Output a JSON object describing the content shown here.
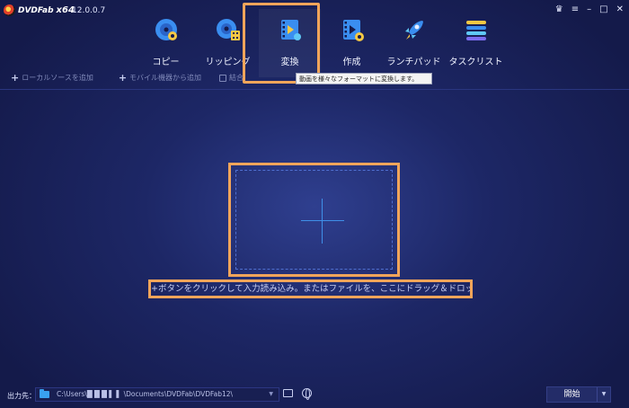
{
  "app": {
    "logo_text": "DVDFab",
    "logo_suffix": "x64",
    "version": "12.0.0.7"
  },
  "window_controls": [
    {
      "name": "skin-icon",
      "glyph": "♛"
    },
    {
      "name": "menu-icon",
      "glyph": "≡"
    },
    {
      "name": "minimize-icon",
      "glyph": "–"
    },
    {
      "name": "maximize-icon",
      "glyph": "□"
    },
    {
      "name": "close-icon",
      "glyph": "✕"
    }
  ],
  "modules": [
    {
      "id": "copy",
      "label": "コピー",
      "icon": "copy-disc-icon"
    },
    {
      "id": "ripper",
      "label": "リッピング",
      "icon": "ripper-disc-icon"
    },
    {
      "id": "converter",
      "label": "変換",
      "icon": "converter-film-icon",
      "active": true
    },
    {
      "id": "creator",
      "label": "作成",
      "icon": "creator-film-icon"
    },
    {
      "id": "launchpad",
      "label": "ランチパッド",
      "icon": "launchpad-rocket-icon"
    },
    {
      "id": "tasks",
      "label": "タスクリスト",
      "icon": "task-list-icon"
    }
  ],
  "toolbar": {
    "add_local": "ローカルソースを追加",
    "add_mobile": "モバイル機器から追加",
    "merge": "結合"
  },
  "tooltip": "動画を様々なフォーマットに変換します。",
  "drop_hint": "+ボタンをクリックして入力読み込み。またはファイルを、ここにドラッグ＆ドロップ",
  "output": {
    "label": "出力先：",
    "path": "C:\\Users\\█ █ █ ▌ ▌ \\Documents\\DVDFab\\DVDFab12\\"
  },
  "start": {
    "label": "開始"
  },
  "colors": {
    "accent": "#f2a55a",
    "background": "#1d2766",
    "plus": "#3f8fe8"
  }
}
